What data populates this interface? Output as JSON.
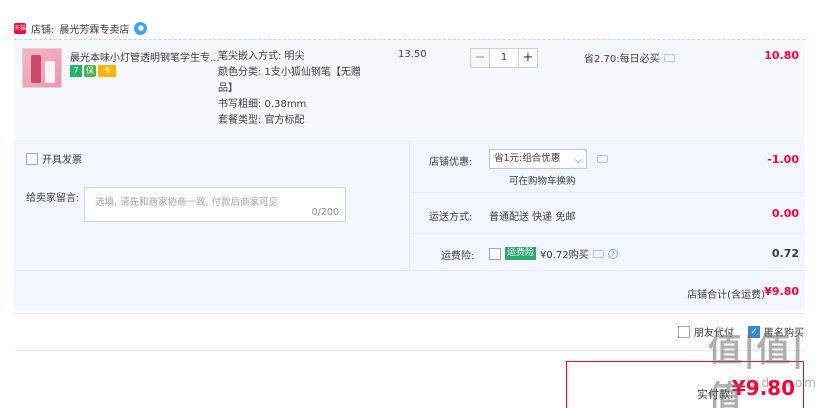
{
  "shop": {
    "store_label": "店铺:",
    "name": "晨光芳霖专卖店",
    "tmall_icon_text": "天猫"
  },
  "item": {
    "title": "晨光本味小灯管透明钢笔学生专...",
    "badges": [
      "7",
      "保",
      "卡"
    ],
    "sku_lines": [
      "笔尖嵌入方式: 明尖",
      "颜色分类: 1支小狐仙钢笔【无赠",
      "品】",
      "书写粗细: 0.38mm",
      "套餐类型: 官方标配"
    ],
    "unit_price": "13.50",
    "quantity": "1",
    "minus": "−",
    "plus": "+",
    "promo": "省2.70:每日必买",
    "subtotal": "10.80"
  },
  "options": {
    "invoice_label": "开具发票",
    "message_label": "给卖家留言:",
    "message_placeholder": "选填, 请先和商家协商一致, 付款后商家可见",
    "message_count": "0/200",
    "shop_discount_label": "店铺优惠:",
    "shop_discount_select": "省1元:组合优惠",
    "shop_discount_hint": "可在购物车换购",
    "shop_discount_value": "-1.00",
    "shipping_label": "运送方式:",
    "shipping_method": "普通配送 快递 免邮",
    "shipping_value": "0.00",
    "insurance_label": "运费险:",
    "insurance_tag": "运费险",
    "insurance_text": "¥0.72购买",
    "insurance_value": "0.72"
  },
  "shop_total": {
    "label": "店铺合计(含运费)",
    "value": "¥9.80"
  },
  "bottom": {
    "anonymous_label": "匿名购买",
    "friend_pay_label": "朋友代付"
  },
  "pay": {
    "label": "实付款:",
    "value": "¥9.80"
  },
  "watermark": {
    "big": "值|值|值",
    "small": "zhide.com"
  },
  "colors": {
    "accent": "#ff0036",
    "panel": "#f2f7ff"
  }
}
